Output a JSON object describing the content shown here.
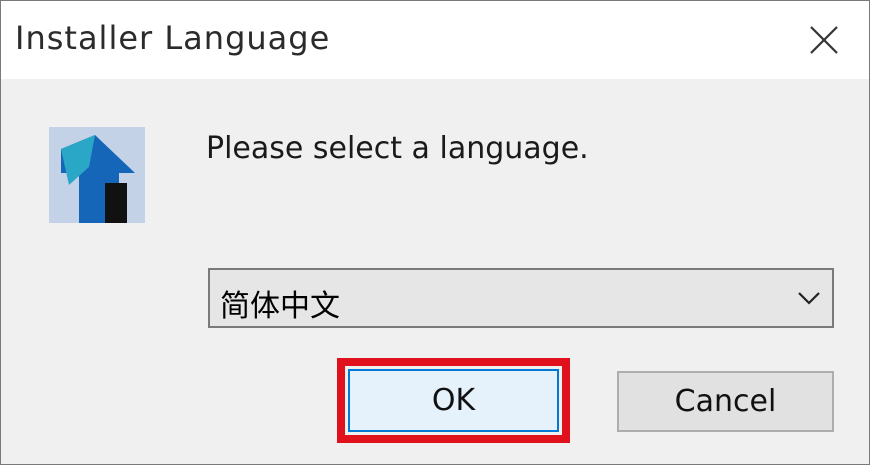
{
  "window": {
    "title": "Installer Language",
    "close_icon": "close-icon"
  },
  "dialog": {
    "app_icon": "installer-house-icon",
    "prompt": "Please select a language.",
    "language_select": {
      "selected": "简体中文",
      "arrow_icon": "chevron-down-icon"
    },
    "buttons": {
      "ok_label": "OK",
      "cancel_label": "Cancel"
    }
  },
  "colors": {
    "highlight_border": "#e0101c",
    "ok_button_border": "#0078d7",
    "ok_button_bg": "#e5f1fb"
  }
}
